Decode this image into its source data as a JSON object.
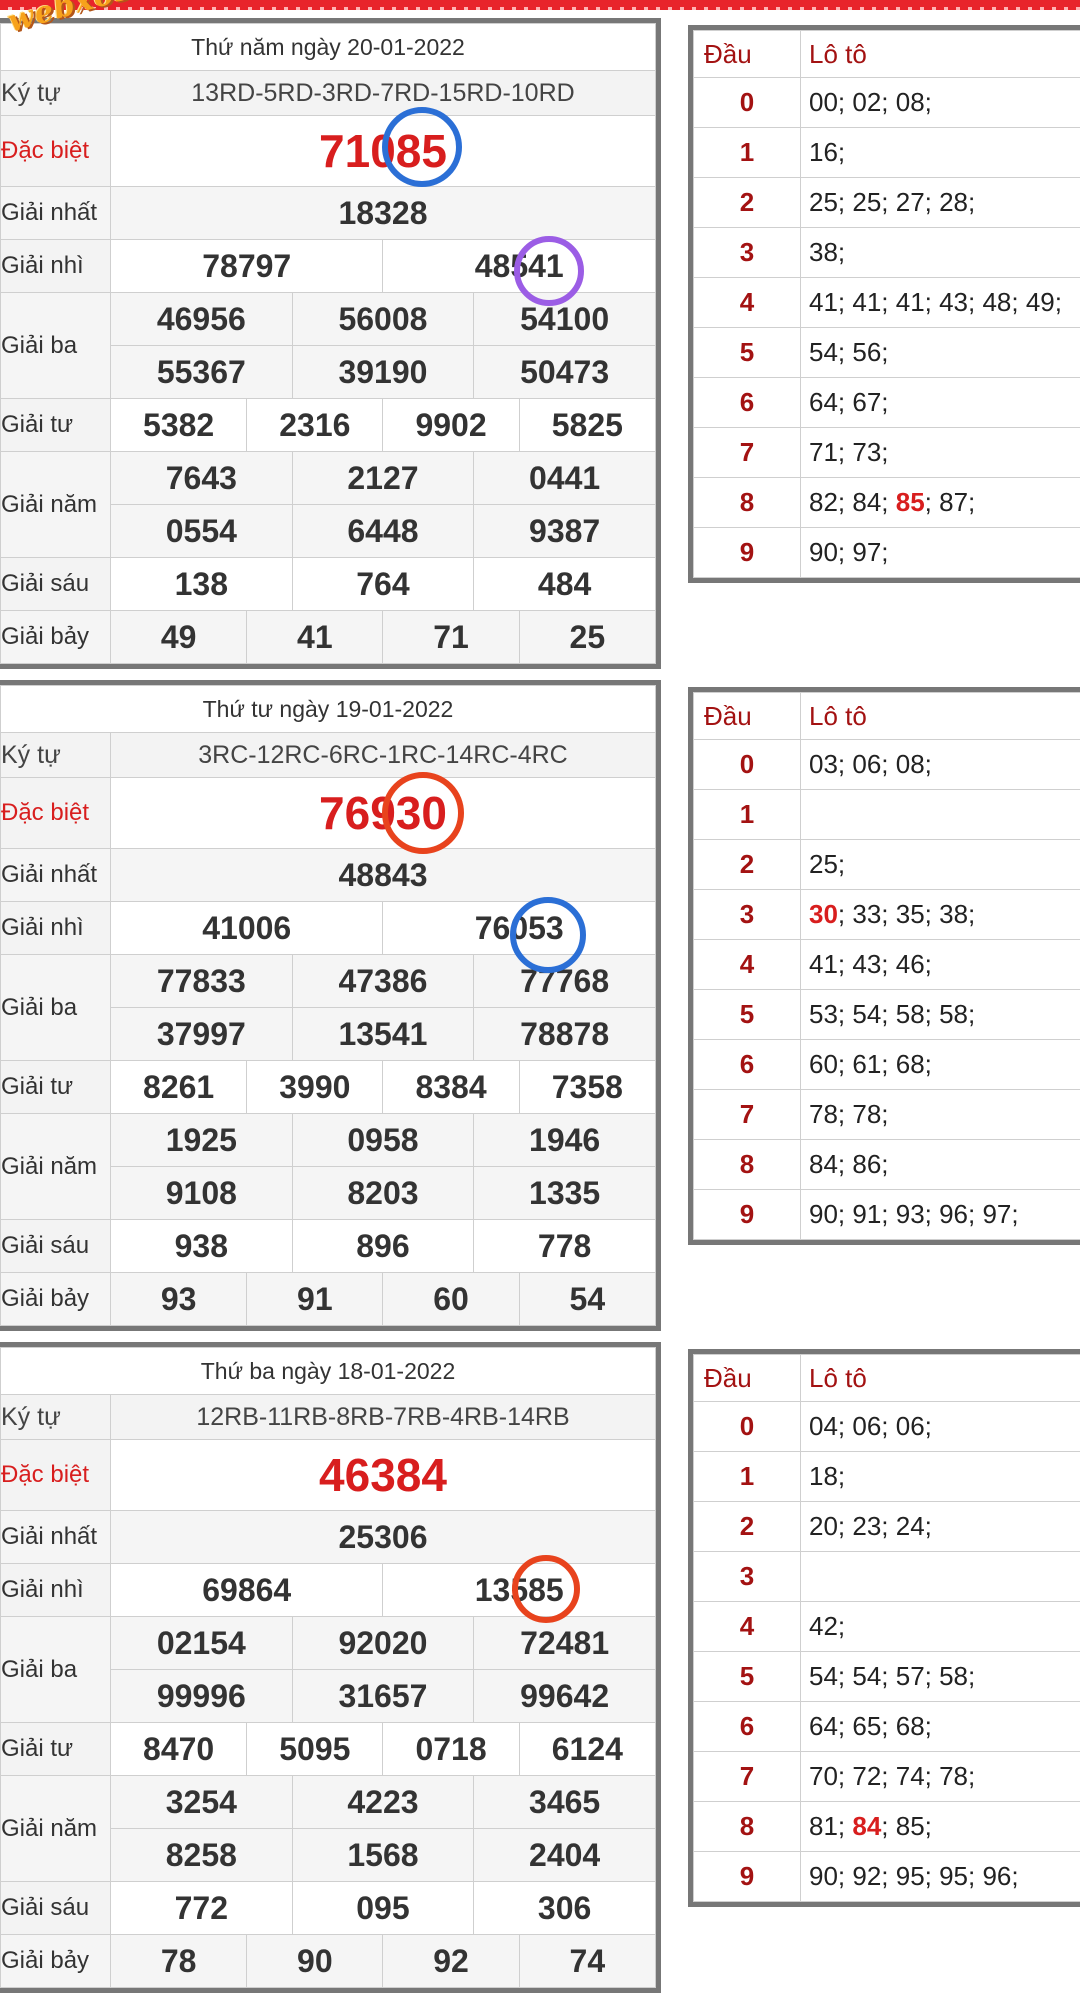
{
  "watermark": "webxoso.net",
  "labels": {
    "ky_tu": "Ký tự",
    "dac_biet": "Đặc biệt",
    "giai_nhat": "Giải nhất",
    "giai_nhi": "Giải nhì",
    "giai_ba": "Giải ba",
    "giai_tu": "Giải tư",
    "giai_nam": "Giải năm",
    "giai_sau": "Giải sáu",
    "giai_bay": "Giải bảy",
    "dau": "Đầu",
    "loto": "Lô tô"
  },
  "draws": [
    {
      "date": "Thứ năm ngày 20-01-2022",
      "ky_tu": "13RD-5RD-3RD-7RD-15RD-10RD",
      "dac_biet": "71085",
      "giai_nhat": "18328",
      "giai_nhi": [
        "78797",
        "48541"
      ],
      "giai_ba": [
        "46956",
        "56008",
        "54100",
        "55367",
        "39190",
        "50473"
      ],
      "giai_tu": [
        "5382",
        "2316",
        "9902",
        "5825"
      ],
      "giai_nam": [
        "7643",
        "2127",
        "0441",
        "0554",
        "6448",
        "9387"
      ],
      "giai_sau": [
        "138",
        "764",
        "484"
      ],
      "giai_bay": [
        "49",
        "41",
        "71",
        "25"
      ],
      "loto": [
        "00; 02; 08;",
        "16;",
        "25; 25; 27; 28;",
        "38;",
        "41; 41; 41; 43; 48; 49;",
        "54; 56;",
        "64; 67;",
        "71; 73;",
        "82; 84; 85; 87;",
        "90; 97;"
      ],
      "highlight": {
        "row": 8,
        "value": "85"
      }
    },
    {
      "date": "Thứ tư ngày 19-01-2022",
      "ky_tu": "3RC-12RC-6RC-1RC-14RC-4RC",
      "dac_biet": "76930",
      "giai_nhat": "48843",
      "giai_nhi": [
        "41006",
        "76053"
      ],
      "giai_ba": [
        "77833",
        "47386",
        "77768",
        "37997",
        "13541",
        "78878"
      ],
      "giai_tu": [
        "8261",
        "3990",
        "8384",
        "7358"
      ],
      "giai_nam": [
        "1925",
        "0958",
        "1946",
        "9108",
        "8203",
        "1335"
      ],
      "giai_sau": [
        "938",
        "896",
        "778"
      ],
      "giai_bay": [
        "93",
        "91",
        "60",
        "54"
      ],
      "loto": [
        "03; 06; 08;",
        "",
        "25;",
        "30; 33; 35; 38;",
        "41; 43; 46;",
        "53; 54; 58; 58;",
        "60; 61; 68;",
        "78; 78;",
        "84; 86;",
        "90; 91; 93; 96; 97;"
      ],
      "highlight": {
        "row": 3,
        "value": "30"
      }
    },
    {
      "date": "Thứ ba ngày 18-01-2022",
      "ky_tu": "12RB-11RB-8RB-7RB-4RB-14RB",
      "dac_biet": "46384",
      "giai_nhat": "25306",
      "giai_nhi": [
        "69864",
        "13585"
      ],
      "giai_ba": [
        "02154",
        "92020",
        "72481",
        "99996",
        "31657",
        "99642"
      ],
      "giai_tu": [
        "8470",
        "5095",
        "0718",
        "6124"
      ],
      "giai_nam": [
        "3254",
        "4223",
        "3465",
        "8258",
        "1568",
        "2404"
      ],
      "giai_sau": [
        "772",
        "095",
        "306"
      ],
      "giai_bay": [
        "78",
        "90",
        "92",
        "74"
      ],
      "loto": [
        "04; 06; 06;",
        "18;",
        "20; 23; 24;",
        "",
        "42;",
        "54; 54; 57; 58;",
        "64; 65; 68;",
        "70; 72; 74; 78;",
        "81; 84; 85;",
        "90; 92; 95; 95; 96;"
      ],
      "highlight": {
        "row": 8,
        "value": "84"
      }
    }
  ],
  "colors": {
    "accent_red": "#d81e1e",
    "ring_blue": "#2b6fd6",
    "ring_purple": "#9b5de5",
    "ring_red": "#e8431d"
  }
}
